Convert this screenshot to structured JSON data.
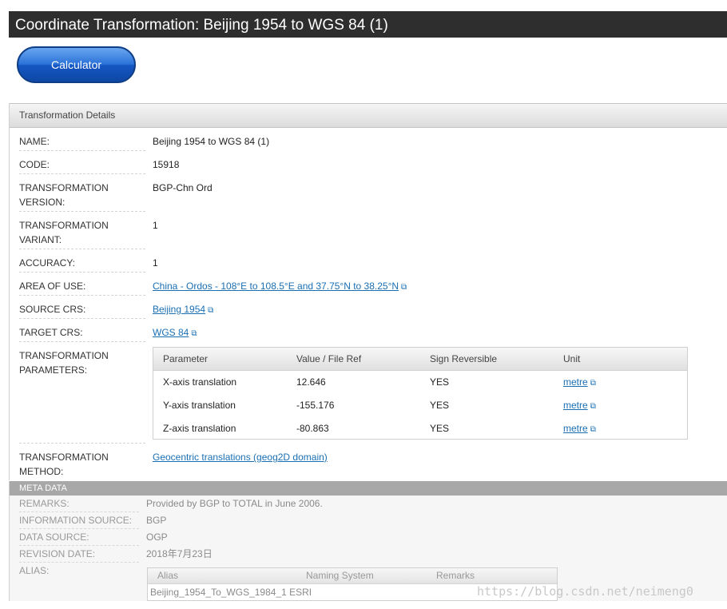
{
  "page": {
    "title": "Coordinate Transformation: Beijing 1954 to WGS 84 (1)"
  },
  "calculator": {
    "label": "Calculator"
  },
  "details": {
    "header": "Transformation Details",
    "name": {
      "label": "NAME:",
      "value": "Beijing 1954 to WGS 84 (1)"
    },
    "code": {
      "label": "CODE:",
      "value": "15918"
    },
    "version": {
      "label_line1": "TRANSFORMATION",
      "label_line2": "VERSION:",
      "value": "BGP-Chn Ord"
    },
    "variant": {
      "label_line1": "TRANSFORMATION",
      "label_line2": "VARIANT:",
      "value": "1"
    },
    "accuracy": {
      "label": "ACCURACY:",
      "value": "1"
    },
    "area": {
      "label": "AREA OF USE:",
      "value": "China - Ordos - 108°E to 108.5°E and 37.75°N to 38.25°N"
    },
    "source_crs": {
      "label": "SOURCE CRS:",
      "value": "Beijing 1954"
    },
    "target_crs": {
      "label": "TARGET CRS:",
      "value": "WGS 84"
    },
    "parameters": {
      "label_line1": "TRANSFORMATION",
      "label_line2": "PARAMETERS:",
      "columns": [
        "Parameter",
        "Value / File Ref",
        "Sign Reversible",
        "Unit"
      ],
      "rows": [
        {
          "parameter": "X-axis translation",
          "value": "12.646",
          "sign": "YES",
          "unit": "metre"
        },
        {
          "parameter": "Y-axis translation",
          "value": "-155.176",
          "sign": "YES",
          "unit": "metre"
        },
        {
          "parameter": "Z-axis translation",
          "value": "-80.863",
          "sign": "YES",
          "unit": "metre"
        }
      ]
    },
    "method": {
      "label_line1": "TRANSFORMATION",
      "label_line2": "METHOD:",
      "value": "Geocentric translations (geog2D domain)"
    }
  },
  "meta": {
    "header": "META DATA",
    "remarks": {
      "label": "REMARKS:",
      "value": "Provided by BGP to TOTAL in June 2006."
    },
    "info_source": {
      "label": "INFORMATION SOURCE:",
      "value": "BGP"
    },
    "data_source": {
      "label": "DATA SOURCE:",
      "value": "OGP"
    },
    "revision_date": {
      "label": "REVISION DATE:",
      "value": "2018年7月23日"
    },
    "alias": {
      "label": "ALIAS:",
      "columns": [
        "Alias",
        "Naming System",
        "Remarks"
      ],
      "row": "Beijing_1954_To_WGS_1984_1 ESRI"
    }
  },
  "watermark": "https://blog.csdn.net/neimeng0",
  "icons": {
    "external_link": "external-link-icon"
  },
  "colors": {
    "title_bar": "#2e2e2e",
    "link": "#1a6fb3",
    "button": "#1556c2",
    "meta_header": "#a8a8a8"
  }
}
